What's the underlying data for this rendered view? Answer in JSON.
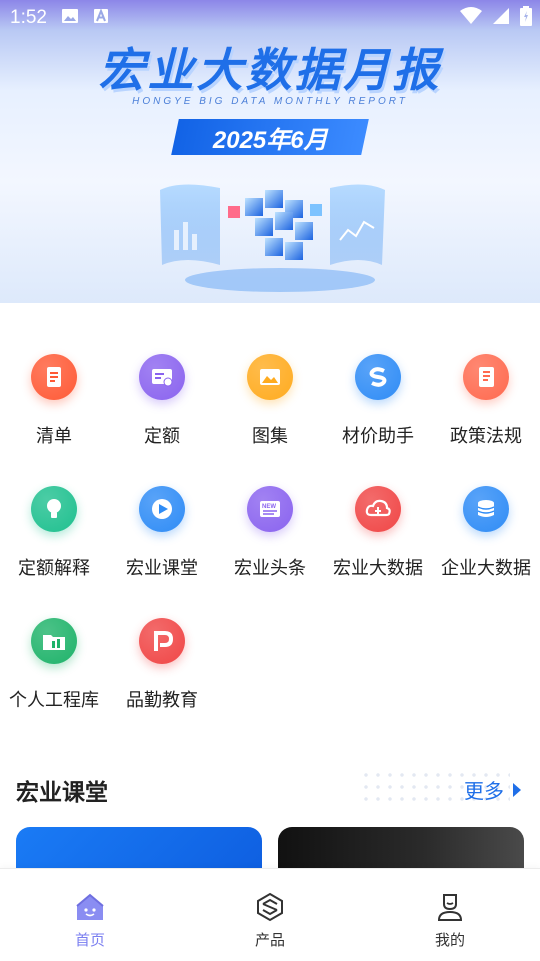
{
  "status_bar": {
    "time": "1:52"
  },
  "banner": {
    "title": "宏业大数据月报",
    "subtitle": "HONGYE BIG DATA MONTHLY REPORT",
    "date": "2025年6月"
  },
  "menu": {
    "items": [
      {
        "label": "清单",
        "icon": "list-icon",
        "color": "#ff5a36"
      },
      {
        "label": "定额",
        "icon": "quota-icon",
        "color": "#8a63ef"
      },
      {
        "label": "图集",
        "icon": "gallery-icon",
        "color": "#ffab1f"
      },
      {
        "label": "材价助手",
        "icon": "price-assistant-icon",
        "color": "#2f8cf6"
      },
      {
        "label": "政策法规",
        "icon": "policy-book-icon",
        "color": "#ff6a4f"
      },
      {
        "label": "定额解释",
        "icon": "lightbulb-icon",
        "color": "#1fc08f"
      },
      {
        "label": "宏业课堂",
        "icon": "play-icon",
        "color": "#2f8cf6"
      },
      {
        "label": "宏业头条",
        "icon": "news-icon",
        "color": "#8a63ef"
      },
      {
        "label": "宏业大数据",
        "icon": "cloud-data-icon",
        "color": "#f04646"
      },
      {
        "label": "企业大数据",
        "icon": "database-icon",
        "color": "#2f8cf6"
      },
      {
        "label": "个人工程库",
        "icon": "folder-icon",
        "color": "#1fb36a"
      },
      {
        "label": "品勤教育",
        "icon": "pinqin-logo-icon",
        "color": "#f04646"
      }
    ]
  },
  "classroom": {
    "title": "宏业课堂",
    "more": "更多"
  },
  "nav": {
    "items": [
      {
        "label": "首页",
        "icon": "home-icon",
        "active": true
      },
      {
        "label": "产品",
        "icon": "product-icon",
        "active": false
      },
      {
        "label": "我的",
        "icon": "profile-icon",
        "active": false
      }
    ]
  },
  "colors": {
    "accent": "#1f6fe8",
    "nav_active": "#7b7ff0",
    "nav_inactive": "#333333"
  }
}
